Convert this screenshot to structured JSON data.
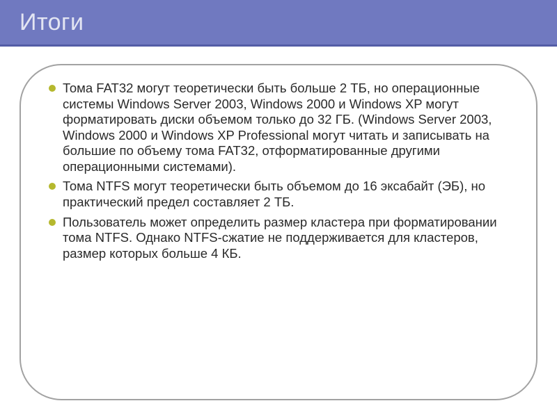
{
  "slide": {
    "title": "Итоги",
    "bullets": [
      "Тома FAT32 могут теоретически быть больше 2 ТБ, но операционные системы Windows Server 2003, Windows 2000 и Windows XP могут форматировать диски объемом только до 32 ГБ. (Windows Server 2003, Windows 2000 и Windows XP Professional могут читать и записывать на большие по объему тома FAT32, отформатированные другими операционными системами).",
      "Тома NTFS могут теоретически быть объемом до 16 эксабайт (ЭБ), но практический предел составляет 2 ТБ.",
      "Пользователь может определить размер кластера при форматировании тома NTFS. Однако NTFS-сжатие не поддерживается для кластеров, размер которых больше 4 КБ."
    ]
  }
}
